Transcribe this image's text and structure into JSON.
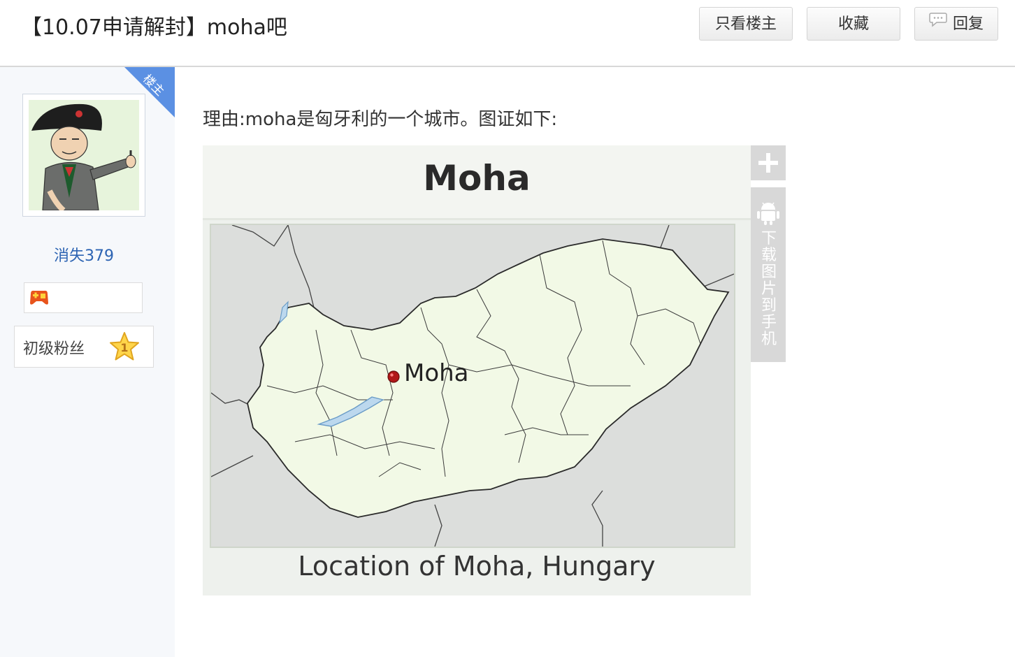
{
  "header": {
    "title": "【10.07申请解封】moha吧",
    "buttons": {
      "only_author": "只看楼主",
      "favorite": "收藏",
      "reply": "回复"
    }
  },
  "sidebar": {
    "author_tag": "楼主",
    "username": "消失379",
    "level": {
      "name": "初级粉丝",
      "number": "1"
    }
  },
  "post": {
    "text": "理由:moha是匈牙利的一个城市。图证如下:",
    "image": {
      "title": "Moha",
      "marker_label": "Moha",
      "caption": "Location of Moha, Hungary"
    },
    "tools": {
      "download_to_phone": "下载图片到手机"
    }
  },
  "colors": {
    "link_blue": "#2d64b3",
    "ribbon_blue": "#5b90e3",
    "map_land": "#f2f9e6",
    "map_bg": "#dcdedc",
    "marker_red": "#b01818"
  }
}
